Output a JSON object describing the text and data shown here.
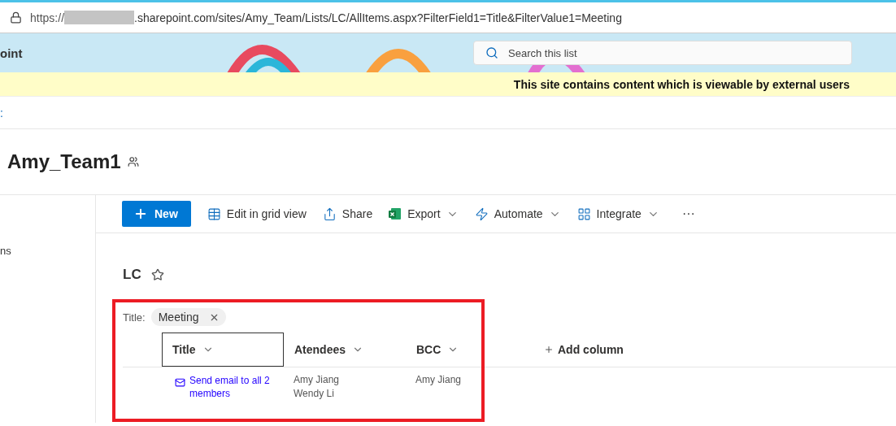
{
  "address_bar": {
    "url_prefix": "https://",
    "url_rest": ".sharepoint.com/sites/Amy_Team/Lists/LC/AllItems.aspx?FilterField1=Title&FilterValue1=Meeting"
  },
  "header": {
    "site_fragment": "oint",
    "search": {
      "placeholder": "Search this list"
    }
  },
  "notice": {
    "lines": [
      "This site contains content which is viewable by external users"
    ]
  },
  "nav_fragment": ":",
  "site_title": "Amy_Team1",
  "sidebar_fragment": "ns",
  "command_bar": [
    {
      "kind": "primary",
      "label": "New"
    },
    {
      "kind": "action",
      "label": "Edit in grid view",
      "dropdown": false
    },
    {
      "kind": "action",
      "label": "Share",
      "dropdown": false
    },
    {
      "kind": "action",
      "label": "Export",
      "dropdown": true
    },
    {
      "kind": "action",
      "label": "Automate",
      "dropdown": true
    },
    {
      "kind": "action",
      "label": "Integrate",
      "dropdown": true
    },
    {
      "kind": "more",
      "label": "···"
    }
  ],
  "list": {
    "name": "LC",
    "favorite": false,
    "filter": {
      "label": "Title:",
      "value": "Meeting"
    },
    "columns": [
      {
        "label": "Title",
        "focused": true
      },
      {
        "label": "Atendees",
        "focused": false
      },
      {
        "label": "BCC",
        "focused": false
      }
    ],
    "add_column": "Add column",
    "rows": [
      {
        "title": "Send email to all 2 members",
        "atendees": [
          "Amy Jiang",
          "Wendy Li"
        ],
        "bcc": [
          "Amy Jiang"
        ]
      }
    ]
  }
}
